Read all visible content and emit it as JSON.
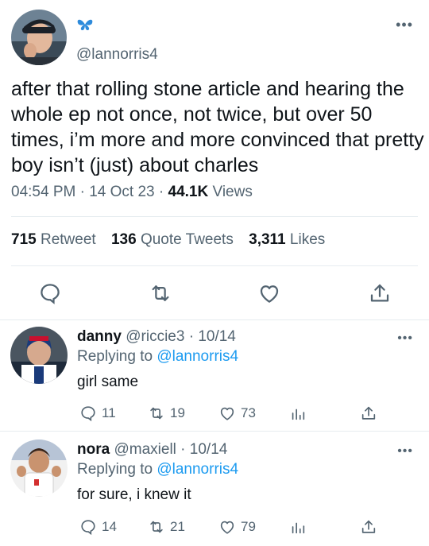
{
  "main_tweet": {
    "verified_emoji": "🦋",
    "handle": "@lannorris4",
    "text": "after that rolling stone article and hearing the whole ep not once, not twice, but over 50 times, i’m more and more convinced that pretty boy isn’t (just) about charles",
    "time": "04:54 PM",
    "date": "14 Oct 23",
    "views_count": "44.1K",
    "views_label": "Views",
    "retweets_count": "715",
    "retweets_label": "Retweet",
    "quotes_count": "136",
    "quotes_label": "Quote Tweets",
    "likes_count": "3,311",
    "likes_label": "Likes"
  },
  "replies": [
    {
      "name": "danny",
      "handle": "@riccie3",
      "date": "10/14",
      "replying_label": "Replying to",
      "replying_to": "@lannorris4",
      "text": "girl same",
      "reply_count": "11",
      "retweet_count": "19",
      "like_count": "73"
    },
    {
      "name": "nora",
      "handle": "@maxiell",
      "date": "10/14",
      "replying_label": "Replying to",
      "replying_to": "@lannorris4",
      "text": "for sure, i knew it",
      "reply_count": "14",
      "retweet_count": "21",
      "like_count": "79"
    }
  ],
  "colors": {
    "text": "#0f1419",
    "muted": "#536471",
    "accent": "#1d9bf0",
    "divider": "#e6ecf0"
  },
  "icons": [
    "verified-butterfly-icon",
    "more-icon",
    "reply-icon",
    "retweet-icon",
    "like-icon",
    "share-icon",
    "analytics-icon"
  ]
}
